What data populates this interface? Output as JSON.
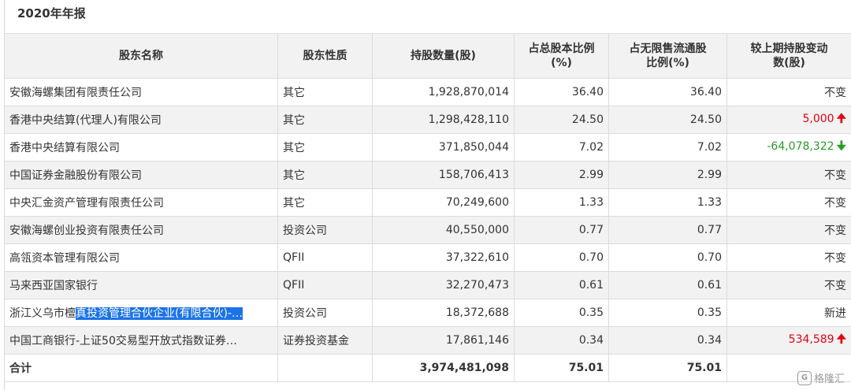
{
  "title": "2020年年报",
  "headers": {
    "name": "股东名称",
    "type": "股东性质",
    "shares": "持股数量(股)",
    "pct_total_l1": "占总股本比例",
    "pct_total_l2": "(%)",
    "pct_float_l1": "占无限售流通股",
    "pct_float_l2": "比例(%)",
    "change_l1": "较上期持股变动",
    "change_l2": "数(股)"
  },
  "rows": [
    {
      "name": "安徽海螺集团有限责任公司",
      "type": "其它",
      "shares": "1,928,870,014",
      "pct_total": "36.40",
      "pct_float": "36.40",
      "change": "不变",
      "dir": "none"
    },
    {
      "name": "香港中央结算(代理人)有限公司",
      "type": "其它",
      "shares": "1,298,428,110",
      "pct_total": "24.50",
      "pct_float": "24.50",
      "change": "5,000",
      "dir": "up"
    },
    {
      "name": "香港中央结算有限公司",
      "type": "其它",
      "shares": "371,850,044",
      "pct_total": "7.02",
      "pct_float": "7.02",
      "change": "-64,078,322",
      "dir": "down"
    },
    {
      "name": "中国证券金融股份有限公司",
      "type": "其它",
      "shares": "158,706,413",
      "pct_total": "2.99",
      "pct_float": "2.99",
      "change": "不变",
      "dir": "none"
    },
    {
      "name": "中央汇金资产管理有限责任公司",
      "type": "其它",
      "shares": "70,249,600",
      "pct_total": "1.33",
      "pct_float": "1.33",
      "change": "不变",
      "dir": "none"
    },
    {
      "name": "安徽海螺创业投资有限责任公司",
      "type": "投资公司",
      "shares": "40,550,000",
      "pct_total": "0.77",
      "pct_float": "0.77",
      "change": "不变",
      "dir": "none"
    },
    {
      "name": "高瓴资本管理有限公司",
      "type": "QFII",
      "shares": "37,322,610",
      "pct_total": "0.70",
      "pct_float": "0.70",
      "change": "不变",
      "dir": "none"
    },
    {
      "name": "马来西亚国家银行",
      "type": "QFII",
      "shares": "32,270,473",
      "pct_total": "0.61",
      "pct_float": "0.61",
      "change": "不变",
      "dir": "none"
    },
    {
      "name_prefix": "浙江义乌市檀",
      "name_highlight": "真投资管理合伙企业(有限合伙)-…",
      "type": "投资公司",
      "shares": "18,372,688",
      "pct_total": "0.35",
      "pct_float": "0.35",
      "change": "新进",
      "dir": "none"
    },
    {
      "name": "中国工商银行-上证50交易型开放式指数证券…",
      "type": "证券投资基金",
      "shares": "17,861,146",
      "pct_total": "0.34",
      "pct_float": "0.34",
      "change": "534,589",
      "dir": "up"
    }
  ],
  "total": {
    "label": "合计",
    "shares": "3,974,481,098",
    "pct_total": "75.01",
    "pct_float": "75.01"
  },
  "arrows": {
    "up": "🠉",
    "down": "🠋"
  },
  "colors": {
    "up": "#e60012",
    "down": "#2b9a2b",
    "highlight": "#1a73e8",
    "stripe": "#f2f2f2"
  },
  "watermark": {
    "icon": "G",
    "text": "格隆汇"
  }
}
